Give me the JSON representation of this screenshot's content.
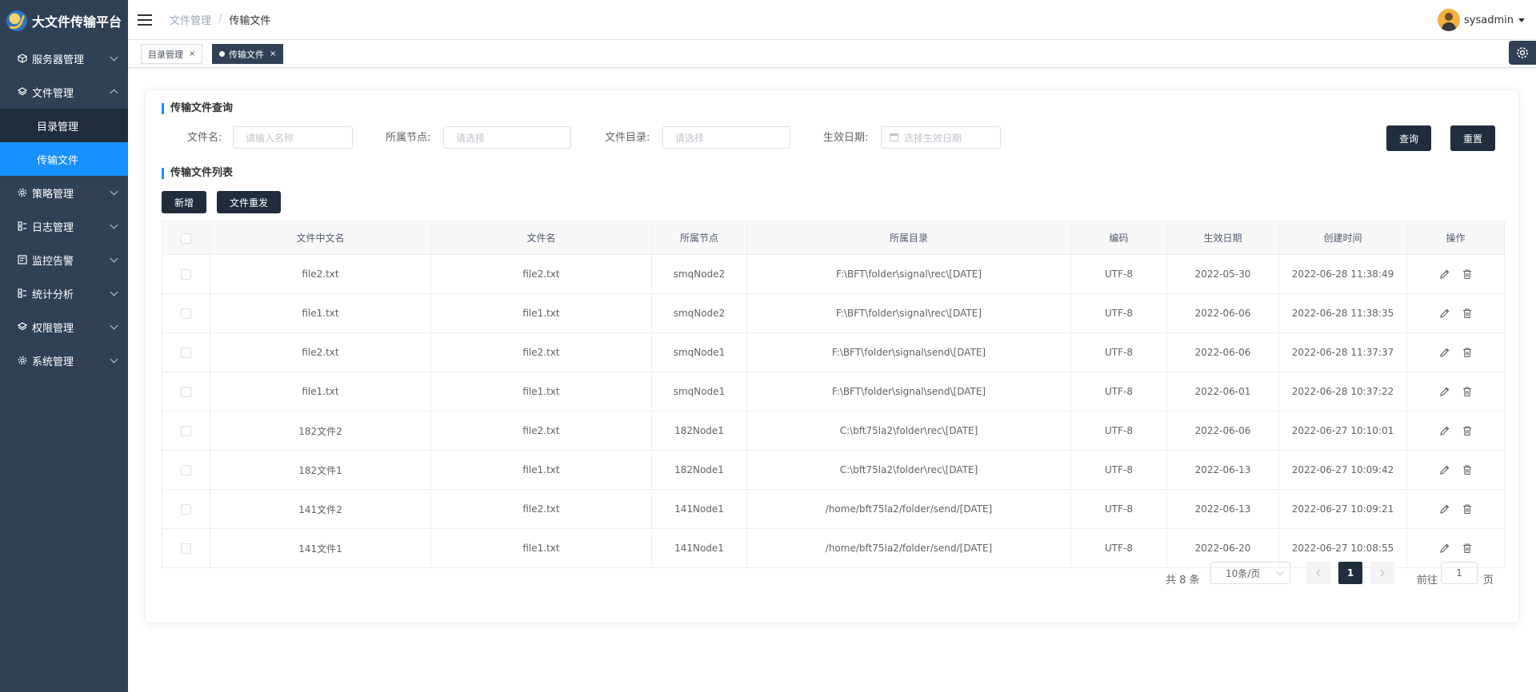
{
  "app": {
    "title": "大文件传输平台"
  },
  "sidebar": {
    "items": [
      {
        "label": "服务器管理",
        "icon": "cube-icon"
      },
      {
        "label": "文件管理",
        "icon": "layers-icon"
      },
      {
        "label": "策略管理",
        "icon": "gear-icon"
      },
      {
        "label": "日志管理",
        "icon": "grid-icon"
      },
      {
        "label": "监控告警",
        "icon": "monitor-icon"
      },
      {
        "label": "统计分析",
        "icon": "chart-icon"
      },
      {
        "label": "权限管理",
        "icon": "layers-icon"
      },
      {
        "label": "系统管理",
        "icon": "gear-icon"
      }
    ],
    "submenu": [
      {
        "label": "目录管理"
      },
      {
        "label": "传输文件"
      }
    ]
  },
  "header": {
    "breadcrumb": [
      "文件管理",
      "/",
      "传输文件"
    ],
    "username": "sysadmin"
  },
  "tags": [
    {
      "label": "目录管理",
      "close": "×"
    },
    {
      "label": "传输文件",
      "close": "×"
    }
  ],
  "query": {
    "title": "传输文件查询",
    "fields": [
      {
        "label": "文件名:",
        "placeholder": "请输入名称"
      },
      {
        "label": "所属节点:",
        "placeholder": "请选择"
      },
      {
        "label": "文件目录:",
        "placeholder": "请选择"
      },
      {
        "label": "生效日期:",
        "placeholder": "选择生效日期"
      }
    ],
    "search_label": "查询",
    "reset_label": "重置"
  },
  "list": {
    "title": "传输文件列表",
    "add_label": "新增",
    "resend_label": "文件重发",
    "columns": [
      "文件中文名",
      "文件名",
      "所属节点",
      "所属目录",
      "编码",
      "生效日期",
      "创建时间",
      "操作"
    ],
    "rows": [
      [
        "file2.txt",
        "file2.txt",
        "smqNode2",
        "F:\\BFT\\folder\\signal\\rec\\[DATE]",
        "UTF-8",
        "2022-05-30",
        "2022-06-28 11:38:49"
      ],
      [
        "file1.txt",
        "file1.txt",
        "smqNode2",
        "F:\\BFT\\folder\\signal\\rec\\[DATE]",
        "UTF-8",
        "2022-06-06",
        "2022-06-28 11:38:35"
      ],
      [
        "file2.txt",
        "file2.txt",
        "smqNode1",
        "F:\\BFT\\folder\\signal\\send\\[DATE]",
        "UTF-8",
        "2022-06-06",
        "2022-06-28 11:37:37"
      ],
      [
        "file1.txt",
        "file1.txt",
        "smqNode1",
        "F:\\BFT\\folder\\signal\\send\\[DATE]",
        "UTF-8",
        "2022-06-01",
        "2022-06-28 10:37:22"
      ],
      [
        "182文件2",
        "file2.txt",
        "182Node1",
        "C:\\bft75la2\\folder\\rec\\[DATE]",
        "UTF-8",
        "2022-06-06",
        "2022-06-27 10:10:01"
      ],
      [
        "182文件1",
        "file1.txt",
        "182Node1",
        "C:\\bft75la2\\folder\\rec\\[DATE]",
        "UTF-8",
        "2022-06-13",
        "2022-06-27 10:09:42"
      ],
      [
        "141文件2",
        "file2.txt",
        "141Node1",
        "/home/bft75la2/folder/send/[DATE]",
        "UTF-8",
        "2022-06-13",
        "2022-06-27 10:09:21"
      ],
      [
        "141文件1",
        "file1.txt",
        "141Node1",
        "/home/bft75la2/folder/send/[DATE]",
        "UTF-8",
        "2022-06-20",
        "2022-06-27 10:08:55"
      ]
    ]
  },
  "pagination": {
    "total": "共 8 条",
    "page_size": "10条/页",
    "current_page": "1",
    "goto_prefix": "前往",
    "goto_value": "1",
    "goto_suffix": "页"
  },
  "colors": {
    "sidebar": "#304156",
    "submenu": "#1f2d3d",
    "active": "#1890ff",
    "button": "#1f2d3d"
  }
}
